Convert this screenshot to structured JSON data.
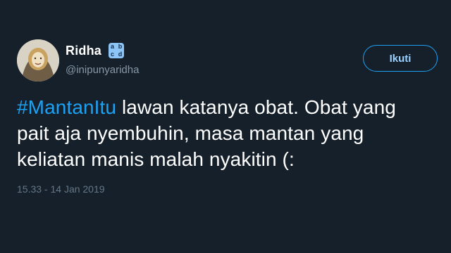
{
  "tweet": {
    "display_name": "Ridha",
    "badge_letters": [
      "a",
      "b",
      "c",
      "d"
    ],
    "handle": "@inipunyaridha",
    "follow_label": "Ikuti",
    "hashtag": "#MantanItu",
    "line1_rest": " lawan katanya obat. Obat yang",
    "line2": "pait aja nyembuhin, masa mantan yang",
    "line3": "keliatan manis malah nyakitin (:",
    "timestamp": "15.33 - 14 Jan 2019"
  },
  "colors": {
    "background": "#15202b",
    "accent": "#1da1f2",
    "secondary_text": "#8899a6"
  }
}
